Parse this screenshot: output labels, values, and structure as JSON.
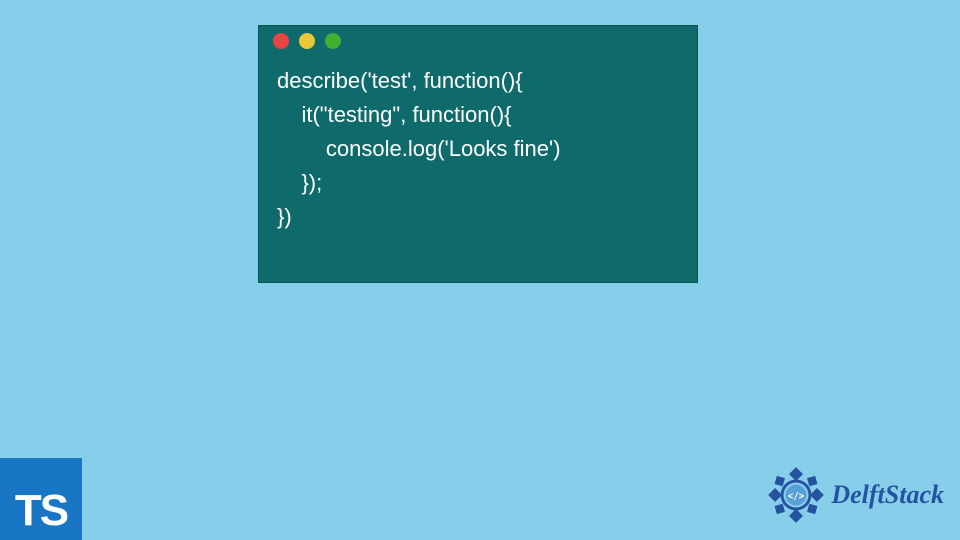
{
  "code": {
    "line1": "describe('test', function(){",
    "line2": "    it(\"testing\", function(){",
    "line3": "        console.log('Looks fine')",
    "line4": "    });",
    "line5": "})"
  },
  "ts_badge": "TS",
  "brand_name": "DelftStack",
  "colors": {
    "background": "#87ceeb",
    "window_bg": "#0f6b6b",
    "dot_red": "#e74444",
    "dot_yellow": "#e9c838",
    "dot_green": "#3fb02f",
    "ts_blue": "#1976c5",
    "brand_blue": "#2553a0"
  }
}
